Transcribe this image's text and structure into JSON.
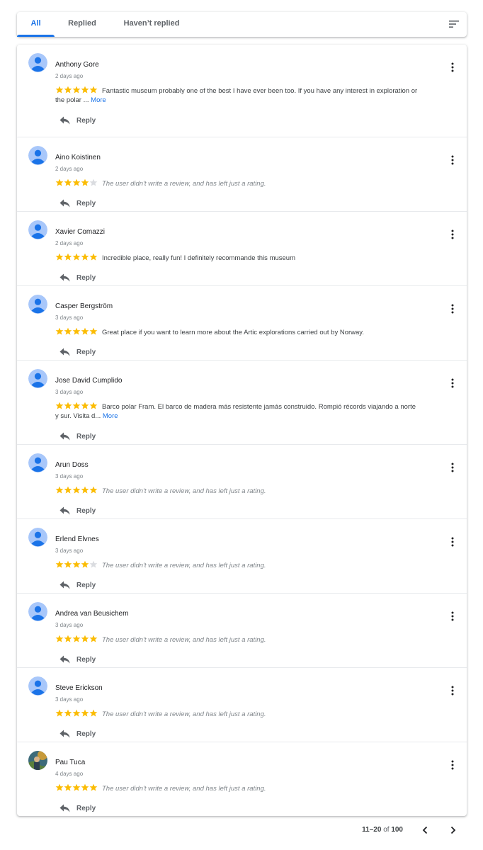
{
  "tabs": [
    {
      "label": "All",
      "active": true
    },
    {
      "label": "Replied",
      "active": false
    },
    {
      "label": "Haven’t replied",
      "active": false
    }
  ],
  "sort_icon": "sort-icon",
  "star_color": "#fbbc04",
  "star_empty_color": "#dadce0",
  "reply_label": "Reply",
  "more_link": "More",
  "no_review_text": "The user didn't write a review, and has left just a rating.",
  "reviews": [
    {
      "name": "Anthony Gore",
      "date": "2 days ago",
      "rating": 5,
      "text_line1": "Fantastic museum probably one of the best I have ever been too. If you have any interest in exploration or",
      "text_line2": "the polar ...",
      "has_more": true
    },
    {
      "name": "Aino Koistinen",
      "date": "2 days ago",
      "rating": 4,
      "text_line1": "",
      "text_line2": "",
      "has_more": false
    },
    {
      "name": "Xavier Comazzi",
      "date": "2 days ago",
      "rating": 5,
      "text_line1": "Incredible place, really fun! I definitely recommande this museum",
      "text_line2": "",
      "has_more": false
    },
    {
      "name": "Casper Bergström",
      "date": "3 days ago",
      "rating": 5,
      "text_line1": "Great place if you want to learn more about the Artic explorations carried out by Norway.",
      "text_line2": "",
      "has_more": false
    },
    {
      "name": "Jose David Cumplido",
      "date": "3 days ago",
      "rating": 5,
      "text_line1": "Barco polar Fram. El barco de madera más resistente jamás construido. Rompió récords viajando a norte",
      "text_line2": "y sur. Visita d...",
      "has_more": true
    },
    {
      "name": "Arun Doss",
      "date": "3 days ago",
      "rating": 5,
      "text_line1": "",
      "text_line2": "",
      "has_more": false
    },
    {
      "name": "Erlend Elvnes",
      "date": "3 days ago",
      "rating": 4,
      "text_line1": "",
      "text_line2": "",
      "has_more": false
    },
    {
      "name": "Andrea van Beusichem",
      "date": "3 days ago",
      "rating": 5,
      "text_line1": "",
      "text_line2": "",
      "has_more": false
    },
    {
      "name": "Steve Erickson",
      "date": "3 days ago",
      "rating": 5,
      "text_line1": "",
      "text_line2": "",
      "has_more": false
    },
    {
      "name": "Pau Tuca",
      "date": "4 days ago",
      "rating": 5,
      "text_line1": "",
      "text_line2": "",
      "has_more": false,
      "photo_avatar": true
    }
  ],
  "pagination": {
    "range": "11–20",
    "of_label": "of",
    "total": "100"
  }
}
